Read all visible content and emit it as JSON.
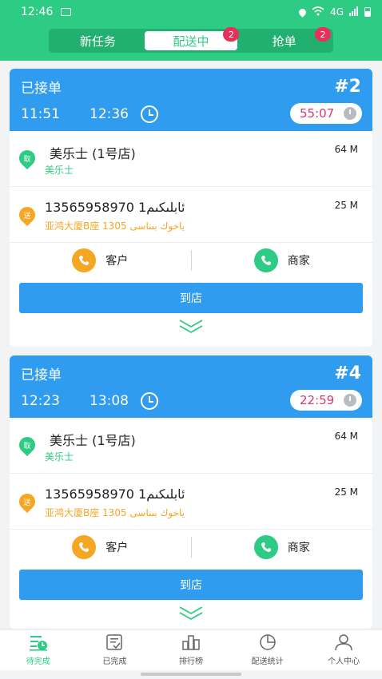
{
  "statusbar": {
    "time": "12:46",
    "signal": "4G"
  },
  "tabs": [
    {
      "label": "新任务",
      "badge": ""
    },
    {
      "label": "配送中",
      "badge": "2"
    },
    {
      "label": "抢单",
      "badge": "2"
    }
  ],
  "orders": [
    {
      "status": "已接单",
      "number": "#2",
      "time_start": "11:51",
      "time_end": "12:36",
      "countdown": "55:07",
      "pickup": {
        "icon_label": "取",
        "name": "美乐士 (1号店)",
        "sub": "美乐士",
        "distance": "64 M"
      },
      "delivery": {
        "icon_label": "送",
        "phone": "13565958970 ئابلىكىم1",
        "address": "亚鸿大厦B座 1305 ياخوك بىناسى",
        "distance": "25 M"
      },
      "contact_customer": "客户",
      "contact_merchant": "商家",
      "action_label": "到店"
    },
    {
      "status": "已接单",
      "number": "#4",
      "time_start": "12:23",
      "time_end": "13:08",
      "countdown": "22:59",
      "pickup": {
        "icon_label": "取",
        "name": "美乐士 (1号店)",
        "sub": "美乐士",
        "distance": "64 M"
      },
      "delivery": {
        "icon_label": "送",
        "phone": "13565958970 ئابلىكىم1",
        "address": "亚鸿大厦B座 1305 ياخوك بىناسى",
        "distance": "25 M"
      },
      "contact_customer": "客户",
      "contact_merchant": "商家",
      "action_label": "到店"
    }
  ],
  "bottom_nav": [
    {
      "label": "待完成",
      "icon": "pending-icon"
    },
    {
      "label": "已完成",
      "icon": "completed-icon"
    },
    {
      "label": "排行榜",
      "icon": "ranking-icon"
    },
    {
      "label": "配送统计",
      "icon": "statistics-icon"
    },
    {
      "label": "个人中心",
      "icon": "profile-icon"
    }
  ],
  "colors": {
    "primary_green": "#2ecb84",
    "card_blue": "#2f9cf0",
    "badge_red": "#e8315a",
    "accent_orange": "#f5a623",
    "countdown_red": "#d63a6a"
  }
}
